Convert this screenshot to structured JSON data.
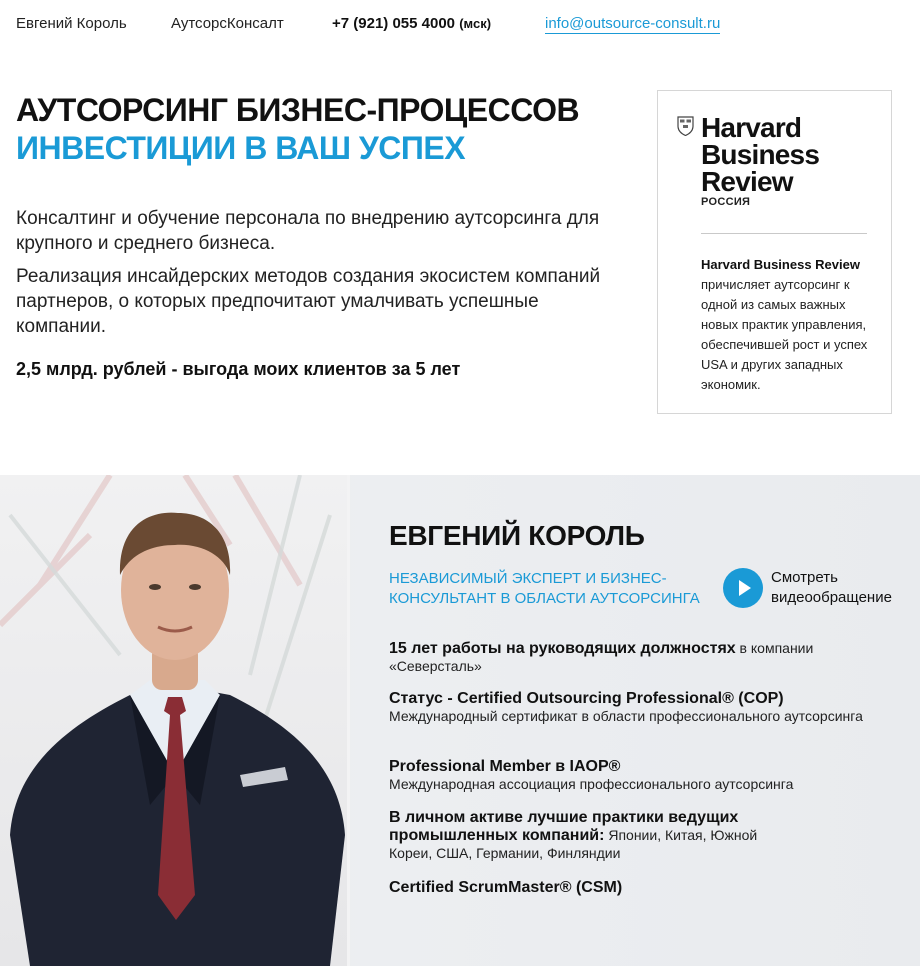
{
  "header": {
    "name": "Евгений Король",
    "company": "АутсорсКонсалт",
    "phone": "+7 (921) 055 4000",
    "phone_suffix": "(мск)",
    "email": "info@outsource-consult.ru"
  },
  "hero": {
    "title": "АУТСОРСИНГ БИЗНЕС-ПРОЦЕССОВ",
    "subtitle": "ИНВЕСТИЦИИ В ВАШ УСПЕХ",
    "paragraph1": "Консалтинг и обучение персонала по внедрению аутсорсинга для крупного и среднего бизнеса.",
    "paragraph2": "Реализация инсайдерских методов создания экосистем компаний партнеров, о которых предпочитают умалчивать успешные компании.",
    "stat": "2,5 млрд. рублей - выгода моих клиентов за 5 лет"
  },
  "hbr": {
    "logo_line1": "Harvard",
    "logo_line2": "Business",
    "logo_line3": "Review",
    "edition": "РОССИЯ",
    "quote_bold": "Harvard Business Review",
    "quote_rest": "причисляет аутсорсинг к одной из самых важных новых практик управления, обеспечившей рост и успех USA и других западных экономик."
  },
  "bio": {
    "name": "ЕВГЕНИЙ КОРОЛЬ",
    "role": "НЕЗАВИСИМЫЙ ЭКСПЕРТ И БИЗНЕС-КОНСУЛЬТАНТ В ОБЛАСТИ АУТСОРСИНГА",
    "video_label": "Смотреть видеообращение",
    "facts": [
      {
        "title": "15 лет работы на руководящих должностях",
        "detail": " в компании «Северсталь»"
      },
      {
        "title": "Статус - Certified Outsourcing Professional® (COP)",
        "detail": "Международный сертификат в области профессионального аутсорсинга"
      },
      {
        "title": "Professional Member в IAOP®",
        "detail": "Международная ассоциация профессионального аутсорсинга"
      },
      {
        "title": "В личном активе лучшие практики ведущих промышленных компаний:",
        "detail": " Японии, Китая, Южной Кореи, США, Германии, Финляндии"
      },
      {
        "title": "Certified ScrumMaster® (CSM)",
        "detail": ""
      }
    ]
  },
  "colors": {
    "accent": "#1a9ad6",
    "text": "#111111",
    "panel": "#eceef1"
  }
}
